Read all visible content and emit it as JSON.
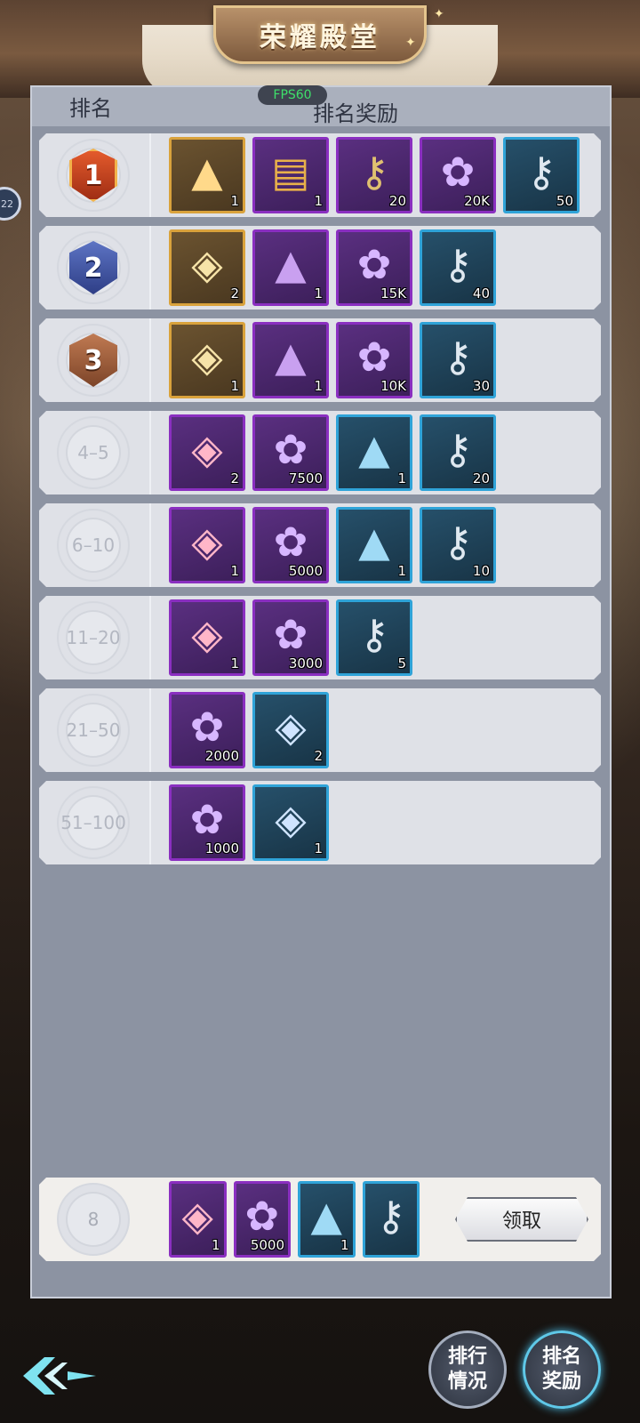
{
  "header": {
    "title": "荣耀殿堂",
    "side_badge": "22"
  },
  "fps_label": "FPS60",
  "panel": {
    "rank_header": "排名",
    "reward_header": "排名奖励"
  },
  "rows": [
    {
      "rank": "1",
      "items": [
        {
          "type": "hat",
          "tier": "gold",
          "qty": "1"
        },
        {
          "type": "chest",
          "tier": "purple",
          "qty": "1"
        },
        {
          "type": "key",
          "tier": "purple",
          "qty": "20"
        },
        {
          "type": "flower",
          "tier": "purple",
          "qty": "20K"
        },
        {
          "type": "key",
          "tier": "blue",
          "qty": "50"
        }
      ]
    },
    {
      "rank": "2",
      "items": [
        {
          "type": "box",
          "tier": "gold",
          "qty": "2"
        },
        {
          "type": "hat",
          "tier": "purple",
          "qty": "1"
        },
        {
          "type": "flower",
          "tier": "purple",
          "qty": "15K"
        },
        {
          "type": "key",
          "tier": "blue",
          "qty": "40"
        }
      ]
    },
    {
      "rank": "3",
      "items": [
        {
          "type": "box",
          "tier": "gold",
          "qty": "1"
        },
        {
          "type": "hat",
          "tier": "purple",
          "qty": "1"
        },
        {
          "type": "flower",
          "tier": "purple",
          "qty": "10K"
        },
        {
          "type": "key",
          "tier": "blue",
          "qty": "30"
        }
      ]
    },
    {
      "rank": "4–5",
      "items": [
        {
          "type": "box",
          "tier": "purple",
          "qty": "2"
        },
        {
          "type": "flower",
          "tier": "purple",
          "qty": "7500"
        },
        {
          "type": "hat",
          "tier": "blue",
          "qty": "1"
        },
        {
          "type": "key",
          "tier": "blue",
          "qty": "20"
        }
      ]
    },
    {
      "rank": "6–10",
      "items": [
        {
          "type": "box",
          "tier": "purple",
          "qty": "1"
        },
        {
          "type": "flower",
          "tier": "purple",
          "qty": "5000"
        },
        {
          "type": "hat",
          "tier": "blue",
          "qty": "1"
        },
        {
          "type": "key",
          "tier": "blue",
          "qty": "10"
        }
      ]
    },
    {
      "rank": "11–20",
      "items": [
        {
          "type": "box",
          "tier": "purple",
          "qty": "1"
        },
        {
          "type": "flower",
          "tier": "purple",
          "qty": "3000"
        },
        {
          "type": "key",
          "tier": "blue",
          "qty": "5"
        }
      ]
    },
    {
      "rank": "21–50",
      "items": [
        {
          "type": "flower",
          "tier": "purple",
          "qty": "2000"
        },
        {
          "type": "box",
          "tier": "blue",
          "qty": "2"
        }
      ]
    },
    {
      "rank": "51–100",
      "items": [
        {
          "type": "flower",
          "tier": "purple",
          "qty": "1000"
        },
        {
          "type": "box",
          "tier": "blue",
          "qty": "1"
        }
      ]
    }
  ],
  "my_rank": {
    "rank": "8",
    "items": [
      {
        "type": "box",
        "tier": "purple",
        "qty": "1"
      },
      {
        "type": "flower",
        "tier": "purple",
        "qty": "5000"
      },
      {
        "type": "hat",
        "tier": "blue",
        "qty": "1"
      },
      {
        "type": "key",
        "tier": "blue",
        "qty": ""
      }
    ],
    "claim_label": "领取"
  },
  "bottom_buttons": {
    "ranking_status": "排行\n情况",
    "ranking_reward": "排名\n奖励"
  }
}
